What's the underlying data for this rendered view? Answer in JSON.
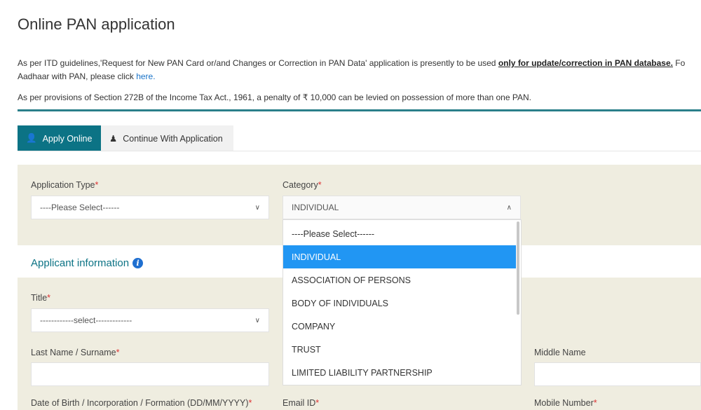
{
  "title": "Online PAN application",
  "notice": {
    "line1_pre": "As per ITD guidelines,'Request for New PAN Card or/and Changes or Correction in PAN Data' application is presently to be used ",
    "line1_bold": "only for update/correction in PAN database.",
    "line1_post": " Fo",
    "line2_pre": "Aadhaar with PAN, please click ",
    "line2_link": "here.",
    "penalty": "As per provisions of Section 272B of the Income Tax Act., 1961, a penalty of ₹ 10,000 can be levied on possession of more than one PAN."
  },
  "tabs": [
    {
      "label": "Apply Online",
      "icon": "user-add-icon",
      "active": true
    },
    {
      "label": "Continue With Application",
      "icon": "user-form-icon",
      "active": false
    }
  ],
  "form": {
    "application_type": {
      "label": "Application Type",
      "value": "----Please Select------"
    },
    "category": {
      "label": "Category",
      "value": "INDIVIDUAL",
      "options": [
        "----Please Select------",
        "INDIVIDUAL",
        "ASSOCIATION OF PERSONS",
        "BODY OF INDIVIDUALS",
        "COMPANY",
        "TRUST",
        "LIMITED LIABILITY PARTNERSHIP"
      ],
      "selected": "INDIVIDUAL"
    },
    "section_title": "Applicant information",
    "title_field": {
      "label": "Title",
      "value": "------------select-------------"
    },
    "last_name": {
      "label": "Last Name / Surname"
    },
    "middle_name": {
      "label": "Middle Name"
    },
    "dob": {
      "label": "Date of Birth / Incorporation / Formation (DD/MM/YYYY)"
    },
    "email": {
      "label": "Email ID"
    },
    "mobile": {
      "label": "Mobile Number"
    },
    "required_mark": "*"
  },
  "colors": {
    "accent": "#0c7385",
    "highlight": "#2196f3",
    "panel": "#efede0"
  }
}
